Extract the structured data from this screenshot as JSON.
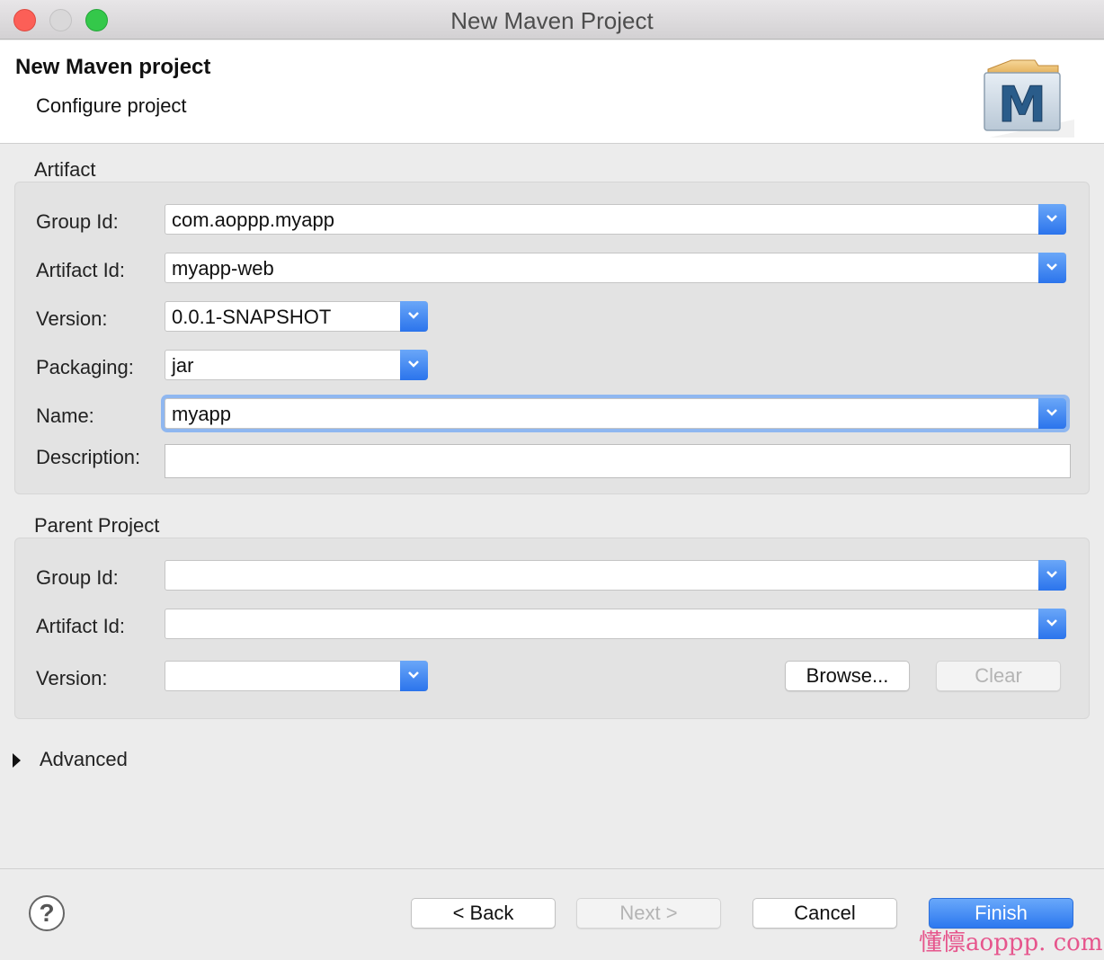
{
  "window": {
    "title": "New Maven Project"
  },
  "header": {
    "title": "New Maven project",
    "subtitle": "Configure project"
  },
  "artifact": {
    "section_title": "Artifact",
    "group_id": {
      "label": "Group Id:",
      "value": "com.aoppp.myapp"
    },
    "artifact_id": {
      "label": "Artifact Id:",
      "value": "myapp-web"
    },
    "version": {
      "label": "Version:",
      "value": "0.0.1-SNAPSHOT"
    },
    "packaging": {
      "label": "Packaging:",
      "value": "jar"
    },
    "name": {
      "label": "Name:",
      "value": "myapp"
    },
    "description": {
      "label": "Description:",
      "value": ""
    }
  },
  "parent": {
    "section_title": "Parent Project",
    "group_id": {
      "label": "Group Id:",
      "value": ""
    },
    "artifact_id": {
      "label": "Artifact Id:",
      "value": ""
    },
    "version": {
      "label": "Version:",
      "value": ""
    },
    "browse_label": "Browse...",
    "clear_label": "Clear"
  },
  "advanced": {
    "label": "Advanced"
  },
  "footer": {
    "help_glyph": "?",
    "back_label": "< Back",
    "next_label": "Next >",
    "cancel_label": "Cancel",
    "finish_label": "Finish"
  },
  "watermark": "懂懔aoppp. com",
  "colors": {
    "accent": "#2b74ec",
    "focus_ring": "#8fb7f0",
    "close": "#fc5f57",
    "zoom": "#34c84a"
  },
  "icons": [
    "maven-logo-icon",
    "chevron-down-icon",
    "disclosure-triangle-icon",
    "help-icon"
  ]
}
